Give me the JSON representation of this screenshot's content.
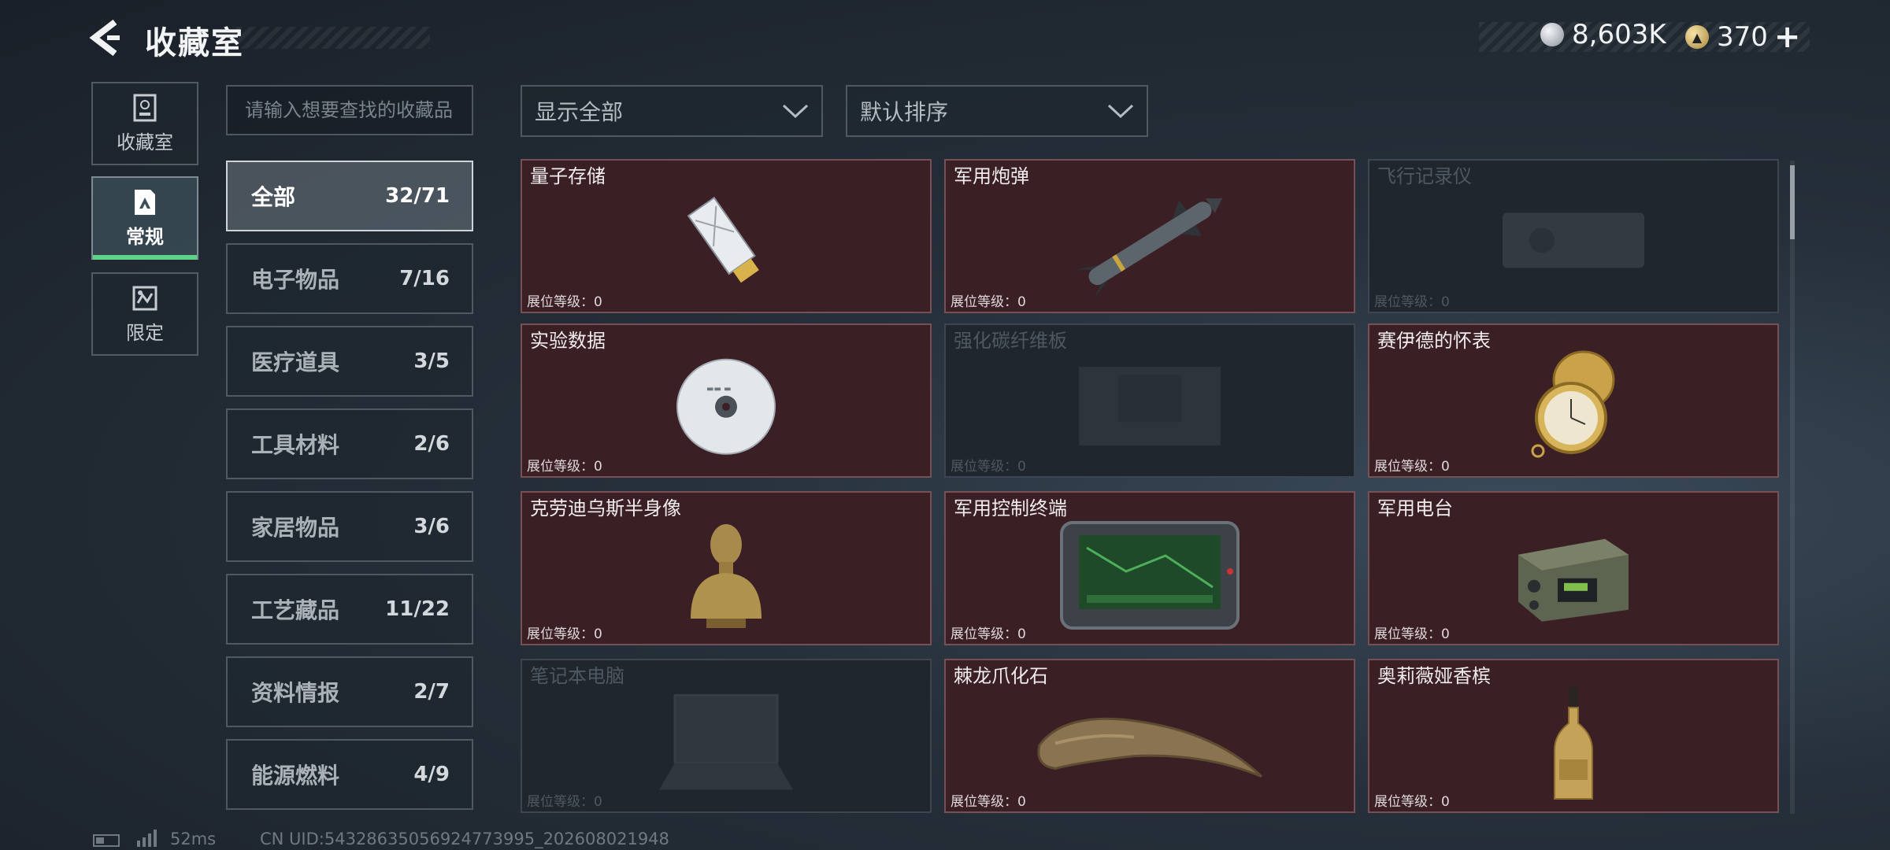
{
  "header": {
    "title": "收藏室",
    "currency_silver": "8,603K",
    "currency_gold": "370",
    "plus": "+"
  },
  "nav": [
    {
      "label": "收藏室",
      "icon": "archive-icon",
      "active": false
    },
    {
      "label": "常规",
      "icon": "image-frame-icon",
      "active": true
    },
    {
      "label": "限定",
      "icon": "limited-icon",
      "active": false
    }
  ],
  "search": {
    "placeholder": "请输入想要查找的收藏品"
  },
  "categories": [
    {
      "name": "全部",
      "count": "32/71",
      "active": true
    },
    {
      "name": "电子物品",
      "count": "7/16"
    },
    {
      "name": "医疗道具",
      "count": "3/5"
    },
    {
      "name": "工具材料",
      "count": "2/6"
    },
    {
      "name": "家居物品",
      "count": "3/6"
    },
    {
      "name": "工艺藏品",
      "count": "11/22"
    },
    {
      "name": "资料情报",
      "count": "2/7"
    },
    {
      "name": "能源燃料",
      "count": "4/9"
    }
  ],
  "filters": {
    "display": "显示全部",
    "sort": "默认排序"
  },
  "level_label": "展位等级：0",
  "items": [
    {
      "name": "量子存储",
      "icon": "usb-drive-icon",
      "owned": true
    },
    {
      "name": "军用炮弹",
      "icon": "missile-icon",
      "owned": true
    },
    {
      "name": "飞行记录仪",
      "icon": "flight-recorder-icon",
      "owned": false
    },
    {
      "name": "实验数据",
      "icon": "disc-icon",
      "owned": true
    },
    {
      "name": "强化碳纤维板",
      "icon": "carbon-plate-icon",
      "owned": false
    },
    {
      "name": "赛伊德的怀表",
      "icon": "pocket-watch-icon",
      "owned": true
    },
    {
      "name": "克劳迪乌斯半身像",
      "icon": "bust-icon",
      "owned": true
    },
    {
      "name": "军用控制终端",
      "icon": "control-terminal-icon",
      "owned": true
    },
    {
      "name": "军用电台",
      "icon": "radio-icon",
      "owned": true
    },
    {
      "name": "笔记本电脑",
      "icon": "laptop-icon",
      "owned": false
    },
    {
      "name": "棘龙爪化石",
      "icon": "claw-fossil-icon",
      "owned": true
    },
    {
      "name": "奥莉薇娅香槟",
      "icon": "champagne-icon",
      "owned": true
    }
  ],
  "status": {
    "ping": "52ms",
    "uid": "CN UID:54328635056924773995_202608021948"
  }
}
